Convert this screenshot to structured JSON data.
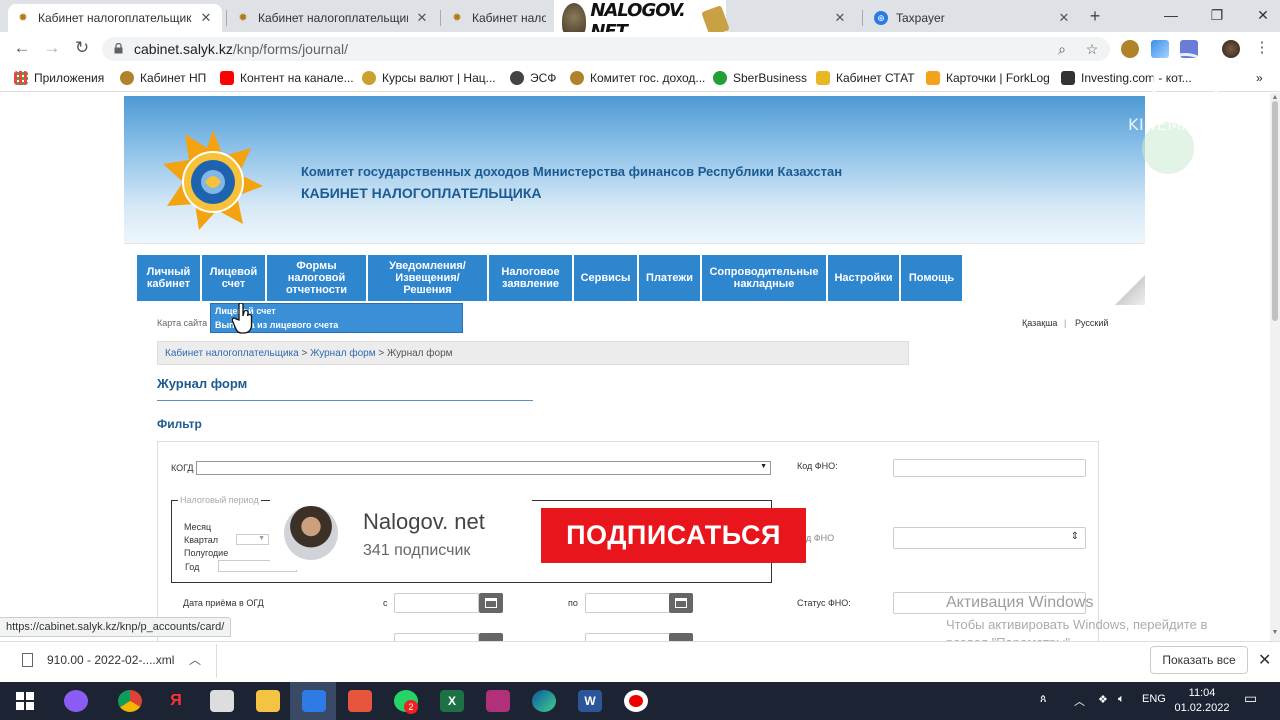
{
  "browser": {
    "tabs": [
      {
        "title": "Кабинет налогоплательщика",
        "active": true
      },
      {
        "title": "Кабинет налогоплательщика",
        "active": false
      },
      {
        "title": "Кабинет налогоп",
        "active": false
      },
      {
        "title": "Taxpayer",
        "active": false
      }
    ],
    "banner_logo_text": "NALOGOV. NET",
    "url_host": "cabinet.salyk.kz",
    "url_path": "/knp/forms/journal/",
    "bookmarks": [
      "Приложения",
      "Кабинет НП",
      "Контент на канале...",
      "Курсы валют | Нац...",
      "ЭСФ",
      "Комитет гос. доход...",
      "SberBusiness",
      "Кабинет СТАТ",
      "Карточки | ForkLog",
      "Investing.com - кот..."
    ]
  },
  "watermark": "KINEMASTER",
  "header": {
    "title1": "Комитет государственных доходов Министерства финансов Республики Казахстан",
    "title2": "КАБИНЕТ НАЛОГОПЛАТЕЛЬЩИКА"
  },
  "menu": [
    "Личный кабинет",
    "Лицевой счет",
    "Формы налоговой отчетности",
    "Уведомления/ Извещения/ Решения",
    "Налоговое заявление",
    "Сервисы",
    "Платежи",
    "Сопроводительные накладные",
    "Настройки",
    "Помощь"
  ],
  "dropdown": {
    "item1": "Лицевой счет",
    "item2": "Выписка из лицевого счета"
  },
  "sitemap": "Карта сайта",
  "lang": {
    "kz": "Қазақша",
    "sep": "|",
    "ru": "Русский"
  },
  "breadcrumb": {
    "link1": "Кабинет налогоплательщика",
    "sep1": " > ",
    "link2": "Журнал форм",
    "sep2": " > ",
    "current": "Журнал форм"
  },
  "page_title": "Журнал форм",
  "filter_title": "Фильтр",
  "filter": {
    "kogd_label": "КОГД",
    "code_fno_label": "Код ФНО:",
    "tax_period_legend": "Налоговый период",
    "month_label": "Месяц",
    "quarter_label": "Квартал",
    "halfyear_label": "Полугодие",
    "year_label": "Год",
    "vid_fno_label": "д ФНО",
    "date_label": "Дата приёма в ОГД",
    "from_label": "с",
    "to_label": "по",
    "status_label": "Статус ФНО:"
  },
  "subscribe": {
    "channel": "Nalogov. net",
    "subscribers": "341 подписчик",
    "button": "ПОДПИСАТЬСЯ"
  },
  "windows_activation": {
    "line1": "Активация Windows",
    "line2": "Чтобы активировать Windows, перейдите в раздел \"Параметры\"."
  },
  "status_url": "https://cabinet.salyk.kz/knp/p_accounts/card/",
  "download": {
    "file": "910.00 - 2022-02-....xml",
    "show_all": "Показать все"
  },
  "taskbar": {
    "lang": "ENG",
    "time": "11:04",
    "date": "01.02.2022",
    "whatsapp_badge": "2"
  }
}
